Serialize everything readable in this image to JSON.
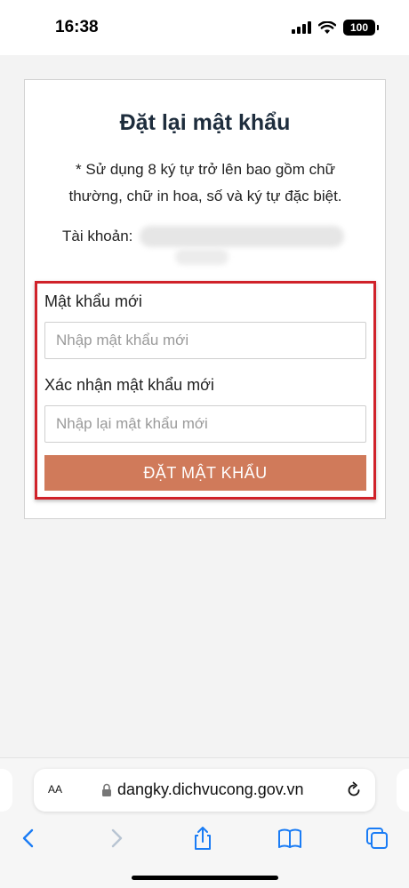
{
  "status": {
    "time": "16:38",
    "battery": "100"
  },
  "card": {
    "title": "Đặt lại mật khẩu",
    "note": "* Sử dụng 8 ký tự trở lên bao gồm chữ thường, chữ in hoa, số và ký tự đặc biệt.",
    "account_label": "Tài khoản:"
  },
  "form": {
    "new_password_label": "Mật khẩu mới",
    "new_password_placeholder": "Nhập mật khẩu mới",
    "confirm_label": "Xác nhận mật khẩu mới",
    "confirm_placeholder": "Nhập lại mật khẩu mới",
    "submit_label": "ĐẶT MẬT KHẨU"
  },
  "browser": {
    "aa_label": "AA",
    "url": "dangky.dichvucong.gov.vn",
    "toolbar_icons": [
      "back-icon",
      "forward-icon",
      "share-icon",
      "bookmarks-icon",
      "tabs-icon"
    ]
  },
  "colors": {
    "submit_button": "#d07a5a",
    "highlight_border": "#d0222a",
    "ios_blue": "#1a7cf5"
  }
}
